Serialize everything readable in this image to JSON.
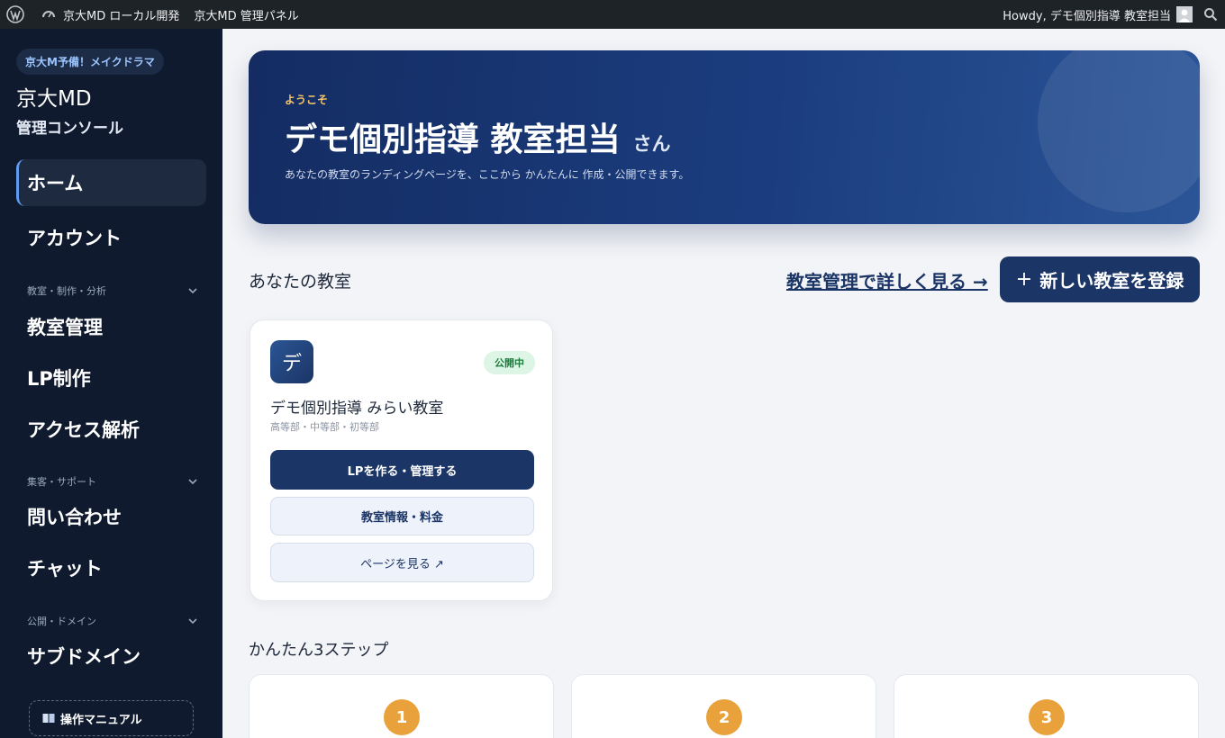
{
  "adminbar": {
    "site_name": "京大MD ローカル開発",
    "panel_name": "京大MD 管理パネル",
    "howdy": "Howdy, デモ個別指導 教室担当"
  },
  "sidebar": {
    "brand_pill": "京大M予備！メイクドラマ",
    "brand_title": "京大MD",
    "brand_sub": "管理コンソール",
    "home": "ホーム",
    "account": "アカウント",
    "group1": "教室・制作・分析",
    "classroom": "教室管理",
    "lp": "LP制作",
    "analytics": "アクセス解析",
    "group2": "集客・サポート",
    "inquiry": "問い合わせ",
    "chat": "チャット",
    "group3": "公開・ドメイン",
    "subdomain": "サブドメイン",
    "manual": "操作マニュアル"
  },
  "hero": {
    "kicker": "ようこそ",
    "name": "デモ個別指導 教室担当",
    "suffix": "さん",
    "desc": "あなたの教室のランディングページを、ここから かんたんに 作成・公開できます。"
  },
  "classrooms": {
    "title": "あなたの教室",
    "more_link": "教室管理で詳しく見る →",
    "new_plus": "+",
    "new_button": "新しい教室を登録"
  },
  "card": {
    "avatar_char": "デ",
    "badge": "公開中",
    "title": "デモ個別指導 みらい教室",
    "subtitle": "高等部・中等部・初等部",
    "btn_lp": "LPを作る・管理する",
    "btn_info": "教室情報・料金",
    "btn_page": "ページを見る ↗"
  },
  "steps": {
    "title": "かんたん3ステップ",
    "items": [
      {
        "number": "1"
      },
      {
        "number": "2"
      },
      {
        "number": "3"
      }
    ]
  },
  "colors": {
    "sidebar_bg": "#0f1a2e",
    "primary": "#1b3566",
    "accent_orange": "#e9a23b",
    "badge_green": "#1f7a3d"
  }
}
